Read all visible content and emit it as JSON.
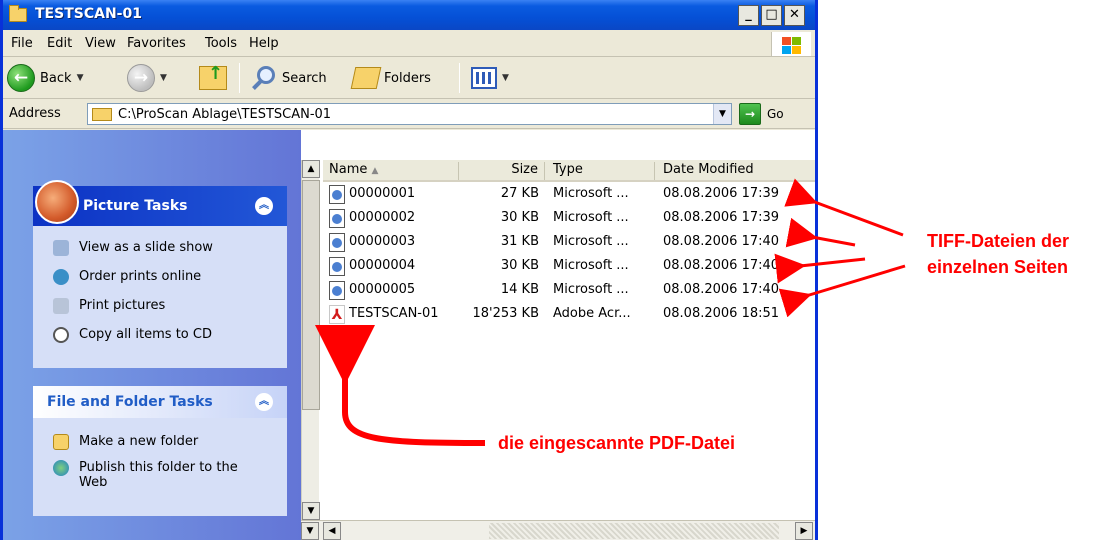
{
  "window": {
    "title": "TESTSCAN-01",
    "minimize": "_",
    "maximize": "□",
    "close": "✕"
  },
  "menu": [
    "File",
    "Edit",
    "View",
    "Favorites",
    "Tools",
    "Help"
  ],
  "toolbar": {
    "back": "Back",
    "search": "Search",
    "folders": "Folders"
  },
  "address": {
    "label": "Address",
    "path": "C:\\ProScan Ablage\\TESTSCAN-01",
    "go": "Go"
  },
  "picture_tasks": {
    "title": "Picture Tasks",
    "items": [
      "View as a slide show",
      "Order prints online",
      "Print pictures",
      "Copy all items to CD"
    ]
  },
  "file_tasks": {
    "title": "File and Folder Tasks",
    "items": [
      "Make a new folder",
      "Publish this folder to the Web"
    ]
  },
  "columns": {
    "name": "Name",
    "size": "Size",
    "type": "Type",
    "date": "Date Modified"
  },
  "files": [
    {
      "name": "00000001",
      "size": "27 KB",
      "type": "Microsoft ...",
      "date": "08.08.2006 17:39",
      "icon": "tiff-icon"
    },
    {
      "name": "00000002",
      "size": "30 KB",
      "type": "Microsoft ...",
      "date": "08.08.2006 17:39",
      "icon": "tiff-icon"
    },
    {
      "name": "00000003",
      "size": "31 KB",
      "type": "Microsoft ...",
      "date": "08.08.2006 17:40",
      "icon": "tiff-icon"
    },
    {
      "name": "00000004",
      "size": "30 KB",
      "type": "Microsoft ...",
      "date": "08.08.2006 17:40",
      "icon": "tiff-icon"
    },
    {
      "name": "00000005",
      "size": "14 KB",
      "type": "Microsoft ...",
      "date": "08.08.2006 17:40",
      "icon": "tiff-icon"
    },
    {
      "name": "TESTSCAN-01",
      "size": "18'253 KB",
      "type": "Adobe Acr...",
      "date": "08.08.2006 18:51",
      "icon": "pdf-icon"
    }
  ],
  "annotations": {
    "tiff_line1": "TIFF-Dateien der",
    "tiff_line2": "einzelnen Seiten",
    "pdf": "die eingescannte PDF-Datei"
  },
  "colors": {
    "annotation": "#ff0000",
    "titlebar": "#0a5be0",
    "taskpane": "#6f8ddf"
  }
}
